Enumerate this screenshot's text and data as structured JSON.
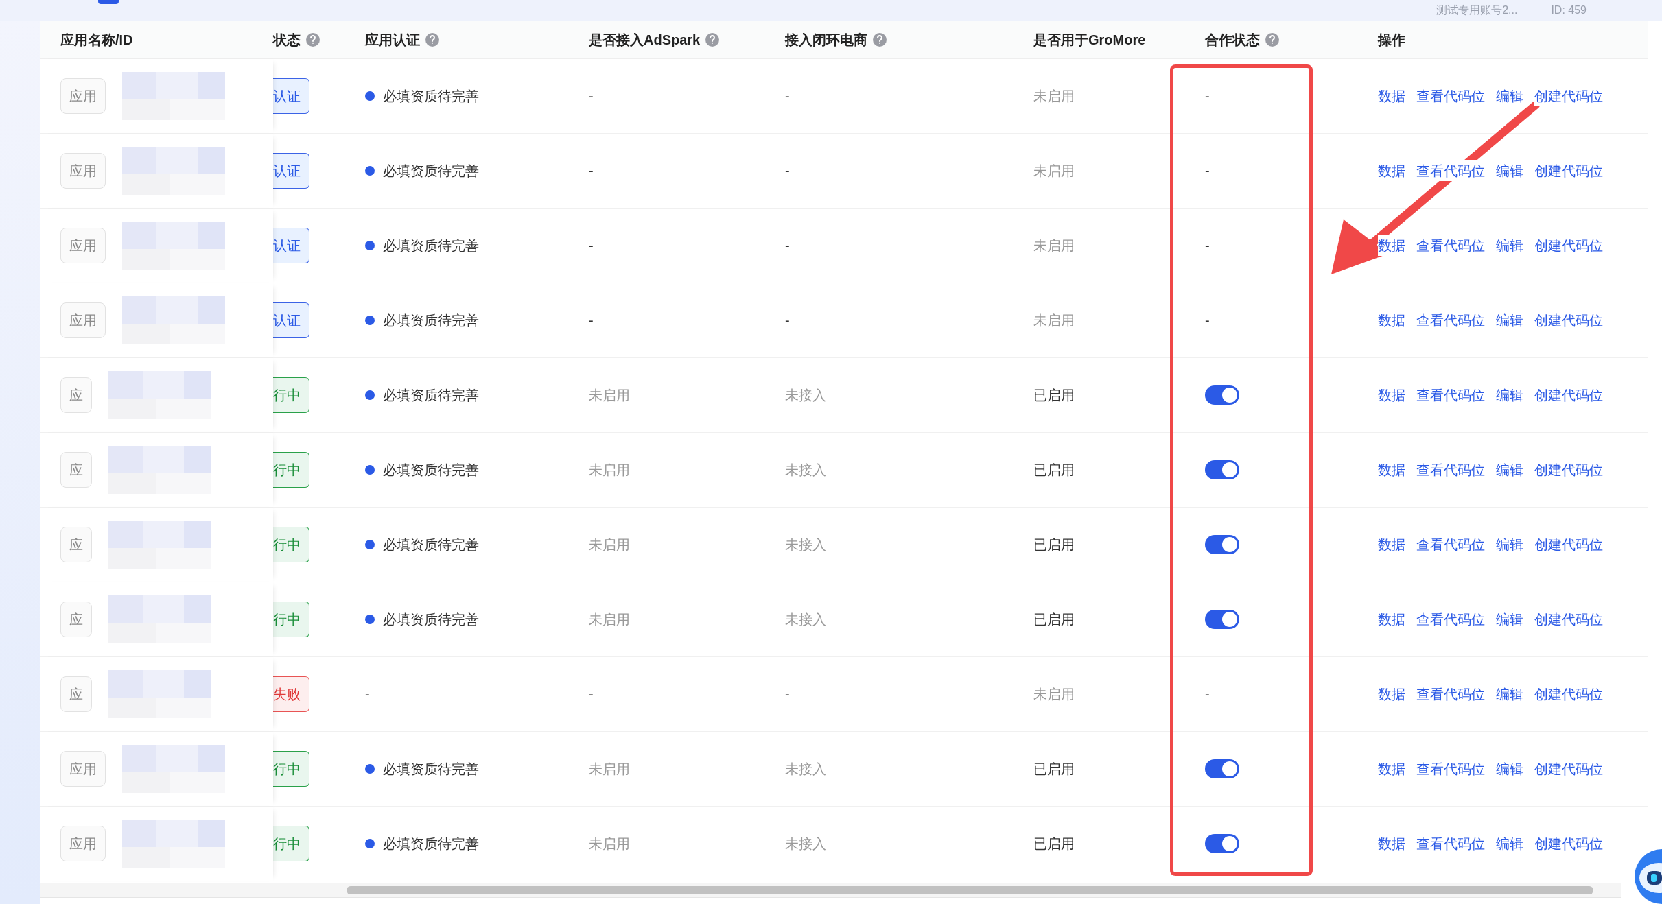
{
  "account": {
    "name": "测试专用账号2...",
    "id": "ID: 459"
  },
  "columns": [
    {
      "label": "应用名称/ID",
      "help": false
    },
    {
      "label": "状态",
      "help": true
    },
    {
      "label": "应用认证",
      "help": true
    },
    {
      "label": "是否接入AdSpark",
      "help": true
    },
    {
      "label": "接入闭环电商",
      "help": true
    },
    {
      "label": "是否用于GroMore",
      "help": false
    },
    {
      "label": "合作状态",
      "help": true
    },
    {
      "label": "操作",
      "help": false
    }
  ],
  "rows": [
    {
      "type_badge": "应用",
      "status": {
        "kind": "pending",
        "label": "认证"
      },
      "cert": {
        "dot": true,
        "text": "必填资质待完善"
      },
      "adspark": {
        "text": "-",
        "muted": false
      },
      "closed_loop": {
        "text": "-",
        "muted": false
      },
      "gromore": {
        "text": "未启用",
        "muted": true
      },
      "cooperation": {
        "kind": "text",
        "text": "-"
      },
      "actions": [
        "数据",
        "查看代码位",
        "编辑",
        "创建代码位"
      ]
    },
    {
      "type_badge": "应用",
      "status": {
        "kind": "pending",
        "label": "认证"
      },
      "cert": {
        "dot": true,
        "text": "必填资质待完善"
      },
      "adspark": {
        "text": "-",
        "muted": false
      },
      "closed_loop": {
        "text": "-",
        "muted": false
      },
      "gromore": {
        "text": "未启用",
        "muted": true
      },
      "cooperation": {
        "kind": "text",
        "text": "-"
      },
      "actions": [
        "数据",
        "查看代码位",
        "编辑",
        "创建代码位"
      ]
    },
    {
      "type_badge": "应用",
      "status": {
        "kind": "pending",
        "label": "认证"
      },
      "cert": {
        "dot": true,
        "text": "必填资质待完善"
      },
      "adspark": {
        "text": "-",
        "muted": false
      },
      "closed_loop": {
        "text": "-",
        "muted": false
      },
      "gromore": {
        "text": "未启用",
        "muted": true
      },
      "cooperation": {
        "kind": "text",
        "text": "-"
      },
      "actions": [
        "数据",
        "查看代码位",
        "编辑",
        "创建代码位"
      ]
    },
    {
      "type_badge": "应用",
      "status": {
        "kind": "pending",
        "label": "认证"
      },
      "cert": {
        "dot": true,
        "text": "必填资质待完善"
      },
      "adspark": {
        "text": "-",
        "muted": false
      },
      "closed_loop": {
        "text": "-",
        "muted": false
      },
      "gromore": {
        "text": "未启用",
        "muted": true
      },
      "cooperation": {
        "kind": "text",
        "text": "-"
      },
      "actions": [
        "数据",
        "查看代码位",
        "编辑",
        "创建代码位"
      ]
    },
    {
      "type_badge": "应",
      "status": {
        "kind": "running",
        "label": "行中"
      },
      "cert": {
        "dot": true,
        "text": "必填资质待完善"
      },
      "adspark": {
        "text": "未启用",
        "muted": true
      },
      "closed_loop": {
        "text": "未接入",
        "muted": true
      },
      "gromore": {
        "text": "已启用",
        "muted": false
      },
      "cooperation": {
        "kind": "switch",
        "on": true
      },
      "actions": [
        "数据",
        "查看代码位",
        "编辑",
        "创建代码位"
      ]
    },
    {
      "type_badge": "应",
      "status": {
        "kind": "running",
        "label": "行中"
      },
      "cert": {
        "dot": true,
        "text": "必填资质待完善"
      },
      "adspark": {
        "text": "未启用",
        "muted": true
      },
      "closed_loop": {
        "text": "未接入",
        "muted": true
      },
      "gromore": {
        "text": "已启用",
        "muted": false
      },
      "cooperation": {
        "kind": "switch",
        "on": true
      },
      "actions": [
        "数据",
        "查看代码位",
        "编辑",
        "创建代码位"
      ]
    },
    {
      "type_badge": "应",
      "status": {
        "kind": "running",
        "label": "行中"
      },
      "cert": {
        "dot": true,
        "text": "必填资质待完善"
      },
      "adspark": {
        "text": "未启用",
        "muted": true
      },
      "closed_loop": {
        "text": "未接入",
        "muted": true
      },
      "gromore": {
        "text": "已启用",
        "muted": false
      },
      "cooperation": {
        "kind": "switch",
        "on": true
      },
      "actions": [
        "数据",
        "查看代码位",
        "编辑",
        "创建代码位"
      ]
    },
    {
      "type_badge": "应",
      "status": {
        "kind": "running",
        "label": "行中"
      },
      "cert": {
        "dot": true,
        "text": "必填资质待完善"
      },
      "adspark": {
        "text": "未启用",
        "muted": true
      },
      "closed_loop": {
        "text": "未接入",
        "muted": true
      },
      "gromore": {
        "text": "已启用",
        "muted": false
      },
      "cooperation": {
        "kind": "switch",
        "on": true
      },
      "actions": [
        "数据",
        "查看代码位",
        "编辑",
        "创建代码位"
      ]
    },
    {
      "type_badge": "应",
      "status": {
        "kind": "failed",
        "label": "失败"
      },
      "cert": {
        "dot": false,
        "text": "-"
      },
      "adspark": {
        "text": "-",
        "muted": false
      },
      "closed_loop": {
        "text": "-",
        "muted": false
      },
      "gromore": {
        "text": "未启用",
        "muted": true
      },
      "cooperation": {
        "kind": "text",
        "text": "-"
      },
      "actions": [
        "数据",
        "查看代码位",
        "编辑",
        "创建代码位"
      ]
    },
    {
      "type_badge": "应用",
      "status": {
        "kind": "running",
        "label": "行中"
      },
      "cert": {
        "dot": true,
        "text": "必填资质待完善"
      },
      "adspark": {
        "text": "未启用",
        "muted": true
      },
      "closed_loop": {
        "text": "未接入",
        "muted": true
      },
      "gromore": {
        "text": "已启用",
        "muted": false
      },
      "cooperation": {
        "kind": "switch",
        "on": true
      },
      "actions": [
        "数据",
        "查看代码位",
        "编辑",
        "创建代码位"
      ]
    },
    {
      "type_badge": "应用",
      "status": {
        "kind": "running",
        "label": "行中"
      },
      "cert": {
        "dot": true,
        "text": "必填资质待完善"
      },
      "adspark": {
        "text": "未启用",
        "muted": true
      },
      "closed_loop": {
        "text": "未接入",
        "muted": true
      },
      "gromore": {
        "text": "已启用",
        "muted": false
      },
      "cooperation": {
        "kind": "switch",
        "on": true
      },
      "actions": [
        "数据",
        "查看代码位",
        "编辑",
        "创建代码位"
      ]
    }
  ]
}
